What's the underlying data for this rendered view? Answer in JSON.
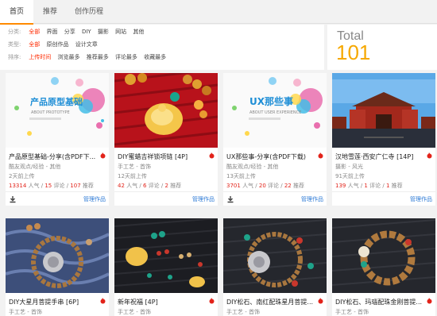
{
  "tabs": [
    {
      "label": "首页",
      "active": true
    },
    {
      "label": "推荐",
      "active": false
    },
    {
      "label": "创作历程",
      "active": false
    }
  ],
  "filters": {
    "category": {
      "label": "分类:",
      "options": [
        "全部",
        "界面",
        "分享",
        "DIY",
        "摄影",
        "网站",
        "其他"
      ],
      "selected": 0
    },
    "type": {
      "label": "类型:",
      "options": [
        "全部",
        "原创作品",
        "设计文章"
      ],
      "selected": 0
    },
    "sort": {
      "label": "排序:",
      "options": [
        "上传时间",
        "浏览最多",
        "推荐最多",
        "评论最多",
        "收藏最多"
      ],
      "selected": 0
    }
  },
  "total": {
    "label": "Total",
    "value": "101"
  },
  "cards_row1": [
    {
      "title": "产品原型基础-分享(含PDF下...",
      "category": "酷友观点/经验 - 其他",
      "time": "2天前上传",
      "views": "13314",
      "comments": "15",
      "recs": "107",
      "thumb_text": "产品原型基础",
      "thumb_sub": "ABOUT PROTOTYPE"
    },
    {
      "title": "DIY蜜蜡吉祥锁项链 [4P]",
      "category": "手工艺 - 首饰",
      "time": "12天前上传",
      "views": "42",
      "comments": "6",
      "recs": "2"
    },
    {
      "title": "UX那些事-分享(含PDF下载)",
      "category": "酷友观点/经验 - 其他",
      "time": "13天前上传",
      "views": "3701",
      "comments": "20",
      "recs": "22",
      "thumb_text": "UX那些事",
      "thumb_sub": "ABOUT USER EXPERIENCE"
    },
    {
      "title": "汉地雪莲·西安广仁寺 [14P]",
      "category": "摄影 - 风光",
      "time": "91天前上传",
      "views": "139",
      "comments": "1",
      "recs": "1"
    }
  ],
  "cards_row2": [
    {
      "title": "DIY大星月菩提手串 [6P]",
      "category": "手工艺 - 首饰"
    },
    {
      "title": "新年祝福 [4P]",
      "category": "手工艺 - 首饰"
    },
    {
      "title": "DIY松石、南红配珠星月菩提...",
      "category": "手工艺 - 首饰"
    },
    {
      "title": "DIY松石、玛瑙配珠金刚菩提...",
      "category": "手工艺 - 首饰"
    }
  ],
  "labels": {
    "views_suffix": "人气",
    "comments_suffix": "评论",
    "recs_suffix": "推荐",
    "separator": " / ",
    "manage": "管理作品"
  },
  "colors": {
    "accent": "#ff8a00",
    "total": "#f6a800",
    "selected": "#ff2a00",
    "link": "#2d7ad6",
    "stat": "#e2231a"
  }
}
